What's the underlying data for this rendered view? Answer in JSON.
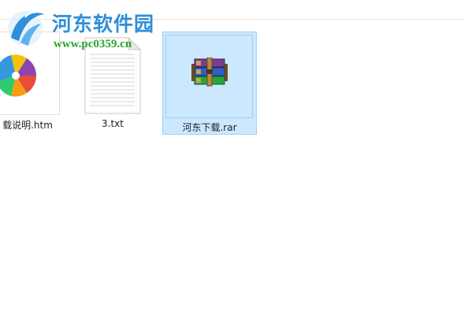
{
  "watermark": {
    "title": "河东软件园",
    "url": "www.pc0359.cn"
  },
  "files": [
    {
      "name": "载说明.htm",
      "icon": "browser-logo-icon",
      "selected": false
    },
    {
      "name": "3.txt",
      "icon": "text-file-icon",
      "selected": false
    },
    {
      "name": "河东下载.rar",
      "icon": "winrar-archive-icon",
      "selected": true
    }
  ],
  "colors": {
    "selection_bg": "#cce8ff",
    "selection_border": "#99d1ff",
    "watermark_blue": "#2f8fd8",
    "watermark_green": "#2aa32a"
  }
}
